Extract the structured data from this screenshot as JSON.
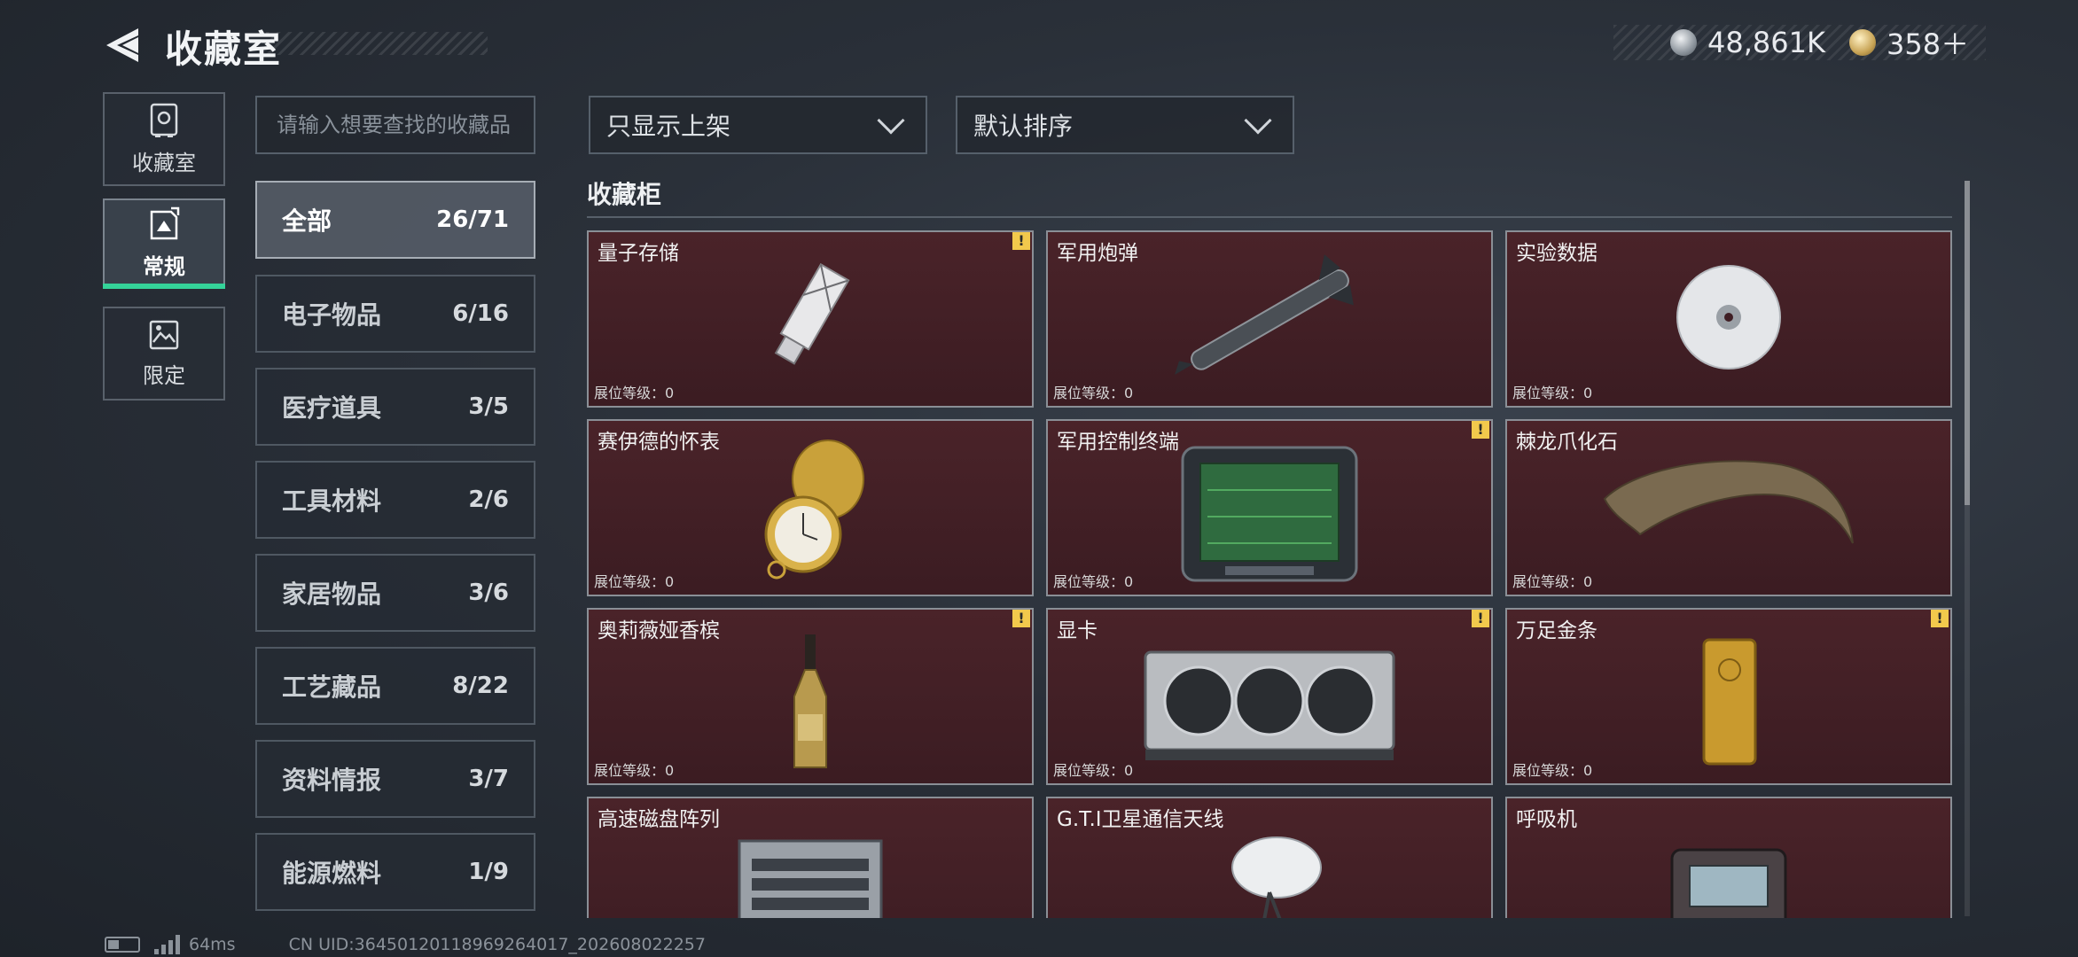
{
  "header": {
    "title": "收藏室",
    "currency": [
      {
        "icon": "silver-coin-icon",
        "value": "48,861K"
      },
      {
        "icon": "gold-coin-icon",
        "value": "358＋"
      }
    ]
  },
  "nav": [
    {
      "label": "收藏室",
      "icon": "safe-icon",
      "active": false
    },
    {
      "label": "常规",
      "icon": "document-icon",
      "active": true
    },
    {
      "label": "限定",
      "icon": "image-icon",
      "active": false
    }
  ],
  "search": {
    "placeholder": "请输入想要查找的收藏品",
    "value": ""
  },
  "categories": [
    {
      "name": "全部",
      "count": "26/71",
      "active": true
    },
    {
      "name": "电子物品",
      "count": "6/16"
    },
    {
      "name": "医疗道具",
      "count": "3/5"
    },
    {
      "name": "工具材料",
      "count": "2/6"
    },
    {
      "name": "家居物品",
      "count": "3/6"
    },
    {
      "name": "工艺藏品",
      "count": "8/22"
    },
    {
      "name": "资料情报",
      "count": "3/7"
    },
    {
      "name": "能源燃料",
      "count": "1/9"
    }
  ],
  "filters": {
    "display": "只显示上架",
    "sort": "默认排序"
  },
  "section_title": "收藏柜",
  "items": [
    {
      "name": "量子存储",
      "level": "展位等级：0",
      "alert": true,
      "icon": "usb-drive-icon"
    },
    {
      "name": "军用炮弹",
      "level": "展位等级：0",
      "alert": false,
      "icon": "missile-icon"
    },
    {
      "name": "实验数据",
      "level": "展位等级：0",
      "alert": false,
      "icon": "disc-icon"
    },
    {
      "name": "赛伊德的怀表",
      "level": "展位等级：0",
      "alert": false,
      "icon": "pocket-watch-icon"
    },
    {
      "name": "军用控制终端",
      "level": "展位等级：0",
      "alert": true,
      "icon": "terminal-icon"
    },
    {
      "name": "棘龙爪化石",
      "level": "展位等级：0",
      "alert": false,
      "icon": "claw-fossil-icon"
    },
    {
      "name": "奥莉薇娅香槟",
      "level": "展位等级：0",
      "alert": true,
      "icon": "champagne-icon"
    },
    {
      "name": "显卡",
      "level": "展位等级：0",
      "alert": true,
      "icon": "graphics-card-icon"
    },
    {
      "name": "万足金条",
      "level": "展位等级：0",
      "alert": true,
      "icon": "gold-bar-icon"
    },
    {
      "name": "高速磁盘阵列",
      "level": "",
      "alert": false,
      "icon": "disk-array-icon"
    },
    {
      "name": "G.T.I卫星通信天线",
      "level": "",
      "alert": false,
      "icon": "satellite-dish-icon"
    },
    {
      "name": "呼吸机",
      "level": "",
      "alert": false,
      "icon": "ventilator-icon"
    }
  ],
  "footer": {
    "ping": "64ms",
    "uid": "CN UID:364501201189692640​17_202608022257"
  },
  "colors": {
    "card_bg": "#3f1e24",
    "active_nav": "#34d399",
    "alert": "#f2c94c"
  }
}
